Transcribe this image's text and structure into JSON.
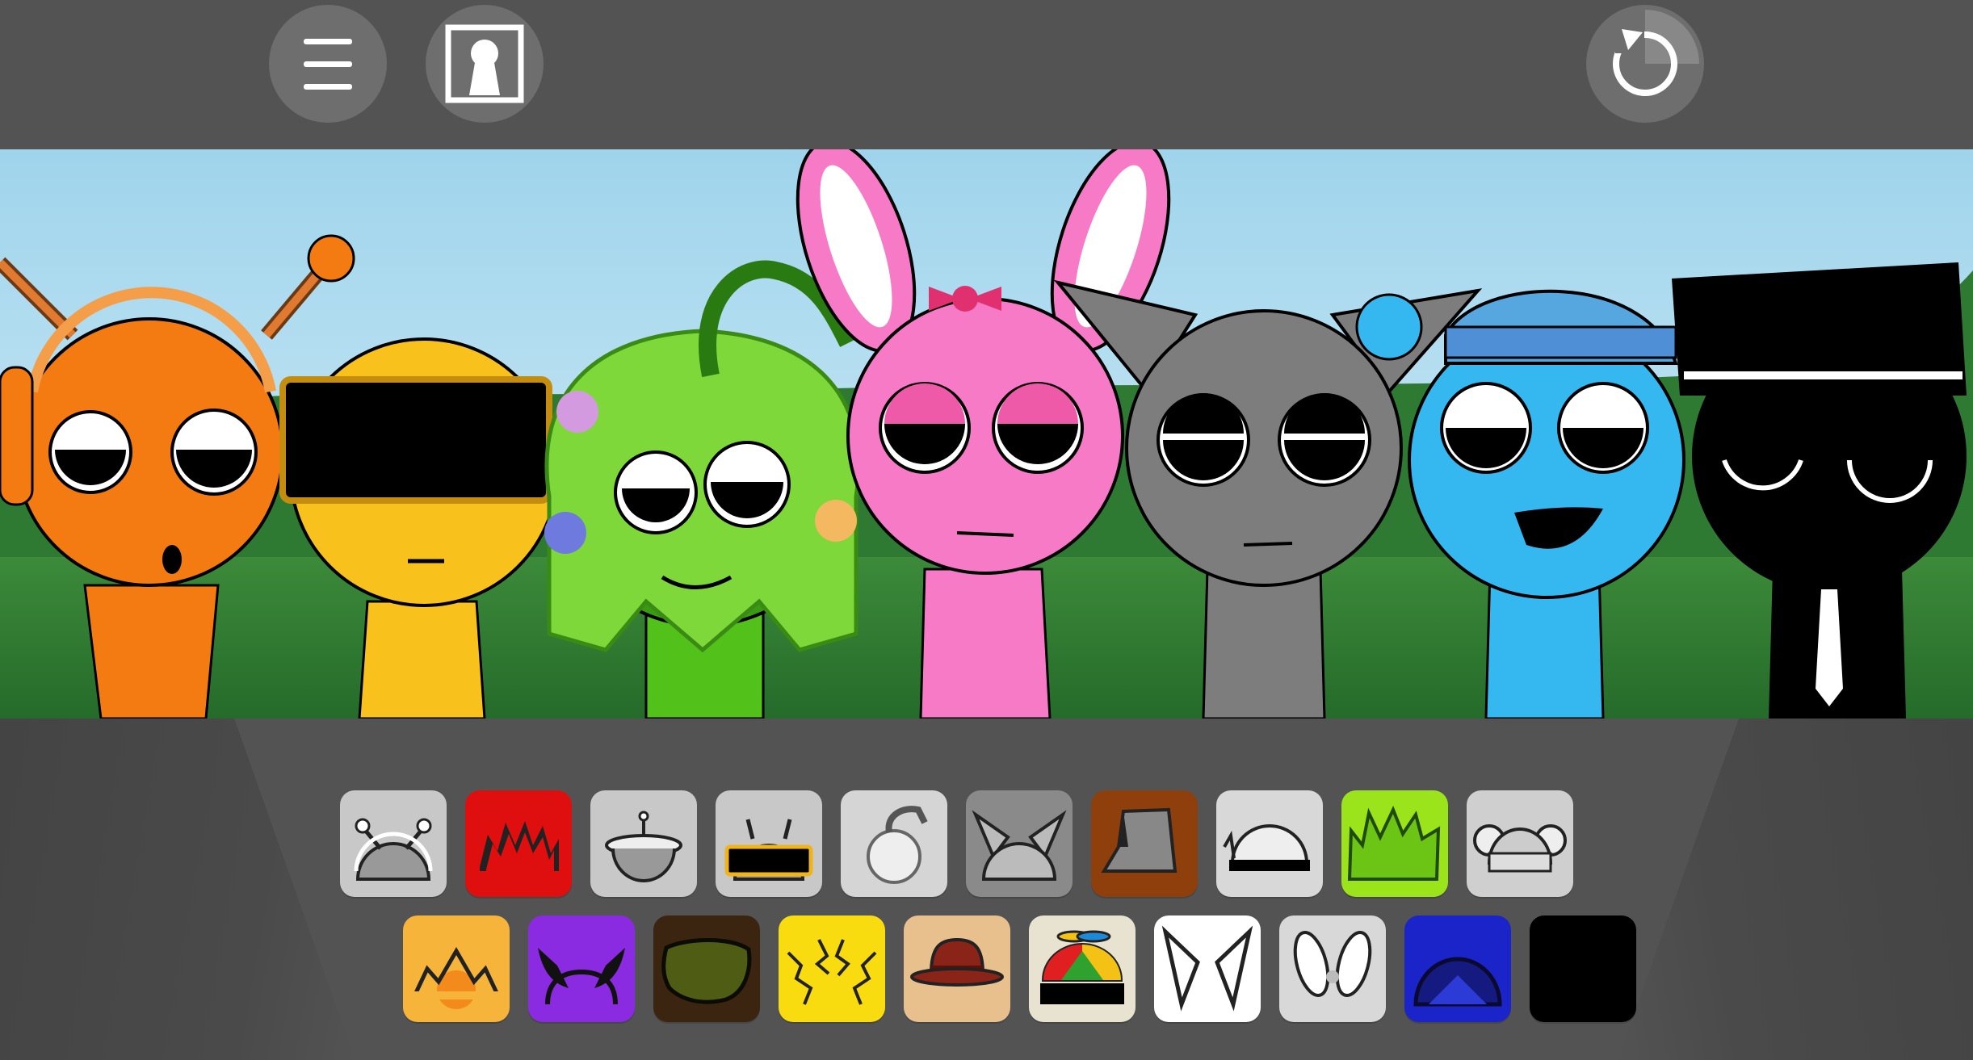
{
  "toolbar": {
    "menu_icon": "hamburger-menu-icon",
    "portrait_icon": "keyhole-portrait-icon",
    "reset_icon": "circular-arrow-reset-icon"
  },
  "stage": {
    "characters": [
      {
        "name": "orange-headphones-character",
        "color": "#f47a12"
      },
      {
        "name": "yellow-visor-character",
        "color": "#f9c11c"
      },
      {
        "name": "green-vine-hair-character",
        "color": "#52c21a"
      },
      {
        "name": "pink-bunny-ears-character",
        "color": "#f77ac7"
      },
      {
        "name": "gray-cat-ears-character",
        "color": "#7d7d7d"
      },
      {
        "name": "blue-beanie-character",
        "color": "#35b7f0"
      },
      {
        "name": "black-top-hat-character",
        "color": "#000000"
      }
    ]
  },
  "tray": {
    "row1": [
      {
        "name": "antenna-headphones-icon",
        "bg": "#c8c8c8",
        "state": "used"
      },
      {
        "name": "red-spiky-hair-icon",
        "bg": "#e00f0f",
        "state": "available"
      },
      {
        "name": "saucer-antenna-icon",
        "bg": "#c8c8c8",
        "state": "used"
      },
      {
        "name": "visor-antenna-icon",
        "bg": "#c8c8c8",
        "state": "used"
      },
      {
        "name": "vine-sprout-icon",
        "bg": "#d5d5d5",
        "state": "used"
      },
      {
        "name": "cat-ears-icon",
        "bg": "#8a8a8a",
        "state": "used"
      },
      {
        "name": "bucket-hat-icon",
        "bg": "#8e3f0c",
        "state": "available"
      },
      {
        "name": "dome-cap-icon",
        "bg": "#d8d8d8",
        "state": "used"
      },
      {
        "name": "green-spiky-hair-icon",
        "bg": "#9be31b",
        "state": "available"
      },
      {
        "name": "bear-ears-beanie-icon",
        "bg": "#cfcfcf",
        "state": "used"
      }
    ],
    "row2": [
      {
        "name": "sun-crown-icon",
        "bg": "#f7b43a",
        "state": "available"
      },
      {
        "name": "devil-horns-icon",
        "bg": "#8a2be2",
        "state": "available"
      },
      {
        "name": "brown-bush-hair-icon",
        "bg": "#3b2410",
        "state": "available"
      },
      {
        "name": "lightning-hair-icon",
        "bg": "#f8dc10",
        "state": "available"
      },
      {
        "name": "fedora-hat-icon",
        "bg": "#e8c08e",
        "state": "available"
      },
      {
        "name": "propeller-cap-icon",
        "bg": "#e8e2d0",
        "state": "available"
      },
      {
        "name": "white-cat-ears-icon",
        "bg": "#ffffff",
        "state": "available"
      },
      {
        "name": "bunny-ears-icon",
        "bg": "#d8d8d8",
        "state": "used"
      },
      {
        "name": "dark-blue-helmet-icon",
        "bg": "#1a24c8",
        "state": "available"
      },
      {
        "name": "black-blank-icon",
        "bg": "#000000",
        "state": "available"
      }
    ]
  }
}
